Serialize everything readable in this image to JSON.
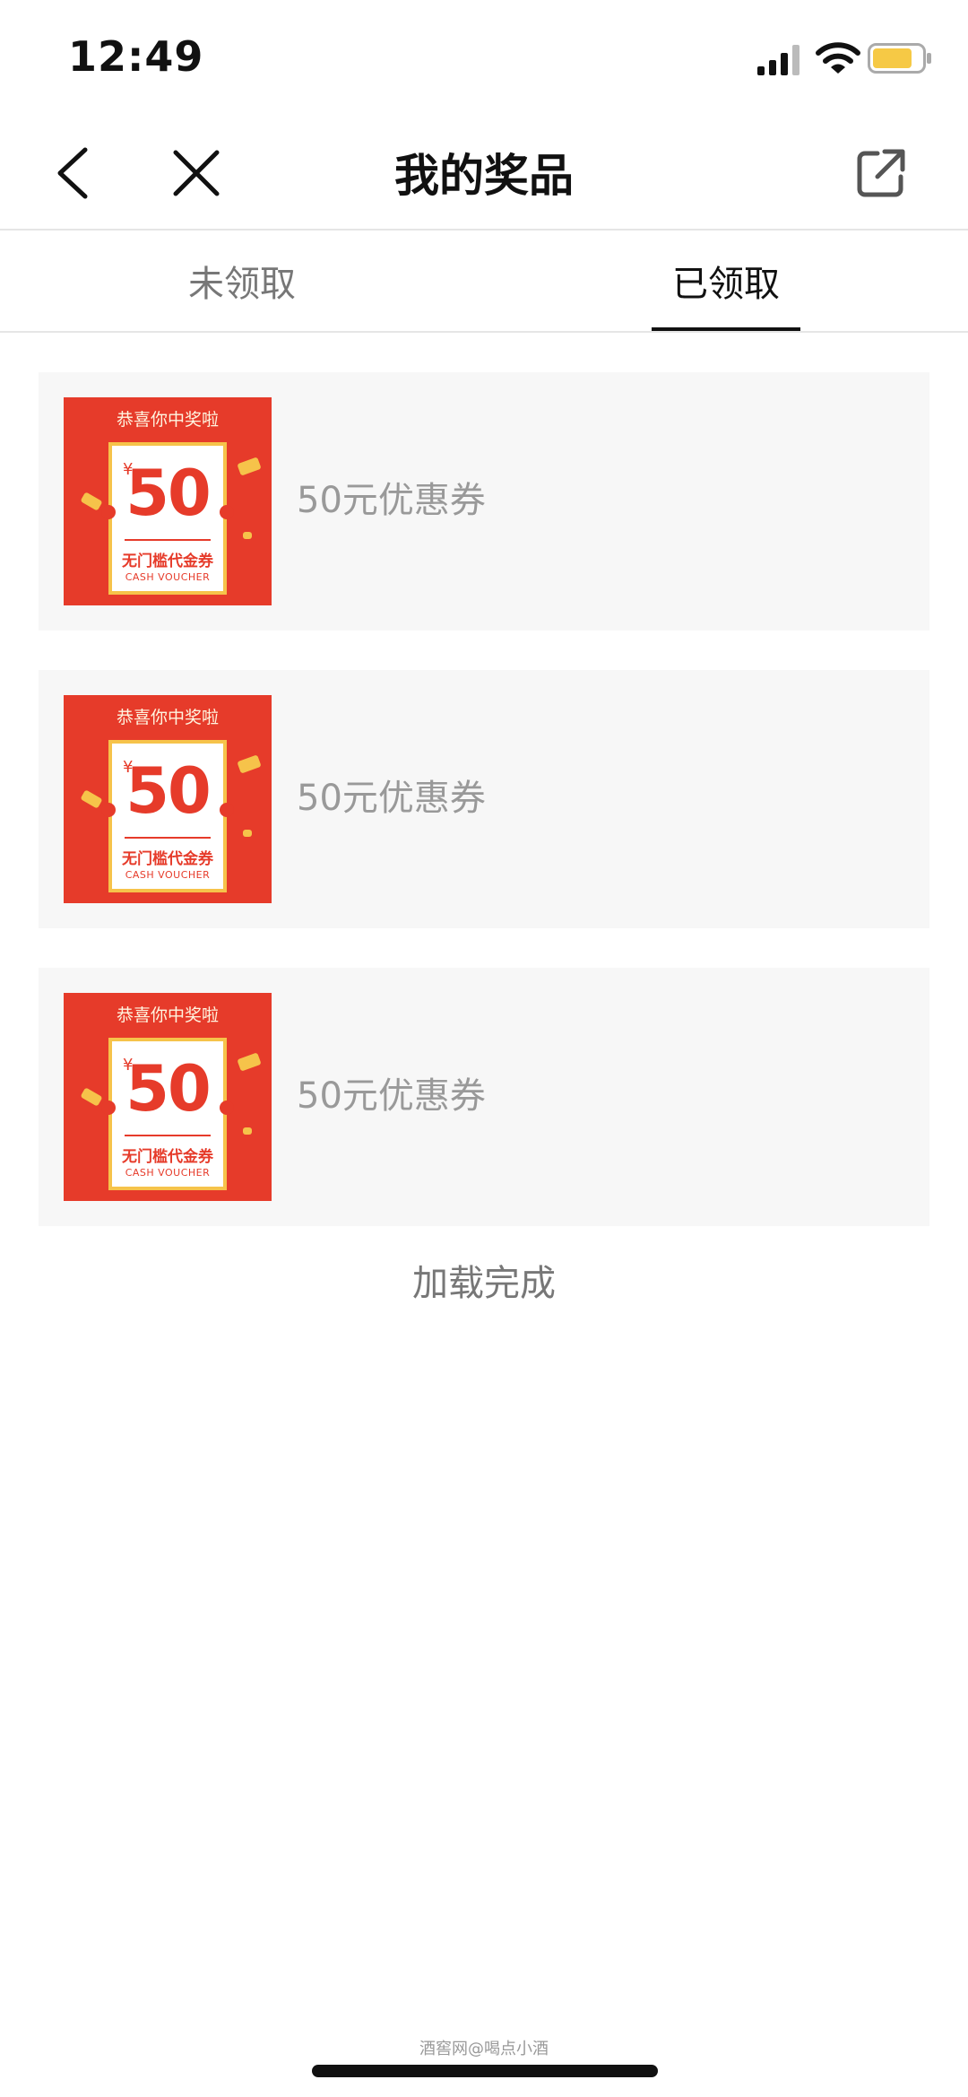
{
  "status_bar": {
    "time": "12:49",
    "battery_color": "#f6c945"
  },
  "nav": {
    "title": "我的奖品",
    "back_icon": "chevron-left-icon",
    "close_icon": "close-icon",
    "share_icon": "external-link-icon"
  },
  "tabs": [
    {
      "label": "未领取",
      "active": false
    },
    {
      "label": "已领取",
      "active": true
    }
  ],
  "voucher": {
    "header": "恭喜你中奖啦",
    "currency": "¥",
    "amount": "50",
    "desc": "无门槛代金券",
    "sub": "CASH VOUCHER",
    "colors": {
      "red": "#e63b2a",
      "gold": "#f6c34a"
    }
  },
  "prizes": [
    {
      "name": "50元优惠券"
    },
    {
      "name": "50元优惠券"
    },
    {
      "name": "50元优惠券"
    }
  ],
  "load_status": "加载完成",
  "watermark": "酒窖网@喝点小酒"
}
